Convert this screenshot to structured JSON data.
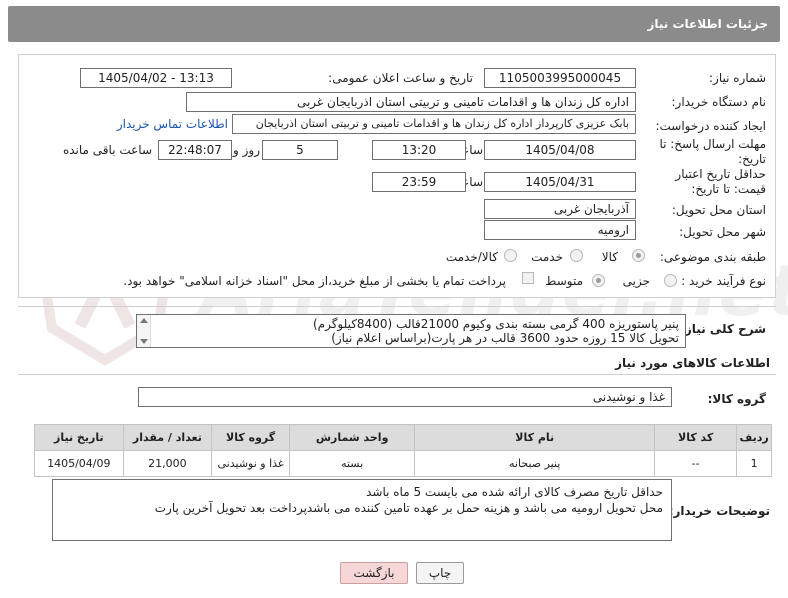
{
  "header": {
    "title": "جزئیات اطلاعات نیاز"
  },
  "fields": {
    "need_number_label": "شماره نیاز:",
    "need_number": "1105003995000045",
    "announce_label": "تاریخ و ساعت اعلان عمومی:",
    "announce_value": "1405/04/02 - 13:13",
    "buyer_org_label": "نام دستگاه خریدار:",
    "buyer_org": "اداره کل زندان ها و اقدامات تامینی و تربیتی استان اذربایجان غربی",
    "creator_label": "ایجاد کننده درخواست:",
    "creator": "بابک عزیزی کارپرداز اداره کل زندان ها و اقدامات تامینی و تربیتی استان اذربایجان",
    "contact_link": "اطلاعات تماس خریدار",
    "reply_deadline_label": "مهلت ارسال پاسخ: تا تاریخ:",
    "reply_date": "1405/04/08",
    "time_label": "ساعت",
    "reply_time": "13:20",
    "days_value": "5",
    "days_label": "روز و",
    "remaining_value": "22:48:07",
    "remaining_label": "ساعت باقی مانده",
    "price_validity_label": "حداقل تاریخ اعتبار قیمت: تا تاریخ:",
    "price_date": "1405/04/31",
    "price_time": "23:59",
    "province_label": "استان محل تحویل:",
    "province": "آذربایجان غربی",
    "city_label": "شهر محل تحویل:",
    "city": "ارومیه",
    "category_label": "طبقه بندی موضوعی:",
    "category_opt_goods": "کالا",
    "category_opt_service": "خدمت",
    "category_opt_both": "کالا/خدمت",
    "process_label": "نوع فرآیند خرید :",
    "process_opt_partial": "جزیی",
    "process_opt_medium": "متوسط",
    "process_note": "پرداخت تمام یا بخشی از مبلغ خرید،از محل \"اسناد خزانه اسلامی\" خواهد بود."
  },
  "description": {
    "label": "شرح کلی نیاز:",
    "line1": "پنیر پاستوریزه  400 گرمی بسته بندی وکیوم  21000قالب  (8400کیلوگرم)",
    "line2": "تحویل کالا 15 روزه حدود 3600 قالب در هر پارت(براساس اعلام نیاز)"
  },
  "goods": {
    "section_title": "اطلاعات کالاهای مورد نیاز",
    "group_label": "گروه کالا:",
    "group_value": "غذا و نوشیدنی",
    "columns": [
      "ردیف",
      "کد کالا",
      "نام کالا",
      "واحد شمارش",
      "گروه کالا",
      "تعداد / مقدار",
      "تاریخ نیاز"
    ],
    "rows": [
      [
        "1",
        "--",
        "پنیر صبحانه",
        "بسته",
        "غذا و نوشیدنی",
        "21,000",
        "1405/04/09"
      ]
    ]
  },
  "buyer_notes": {
    "label": "توضیحات خریدار:",
    "line1": "حداقل تاریخ مصرف کالای ارائه شده می بایست 5 ماه باشد",
    "line2": "محل تحویل ارومیه می باشد  و هزینه حمل بر عهده تامین کننده می باشدپرداخت بعد تحویل آخرین پارت"
  },
  "buttons": {
    "print": "چاپ",
    "back": "بازگشت"
  },
  "watermark": "AriaTender.net",
  "colors": {
    "header_bg": "#8b8b8b",
    "link": "#1a56b0",
    "back_button": "#f6d6d6"
  }
}
